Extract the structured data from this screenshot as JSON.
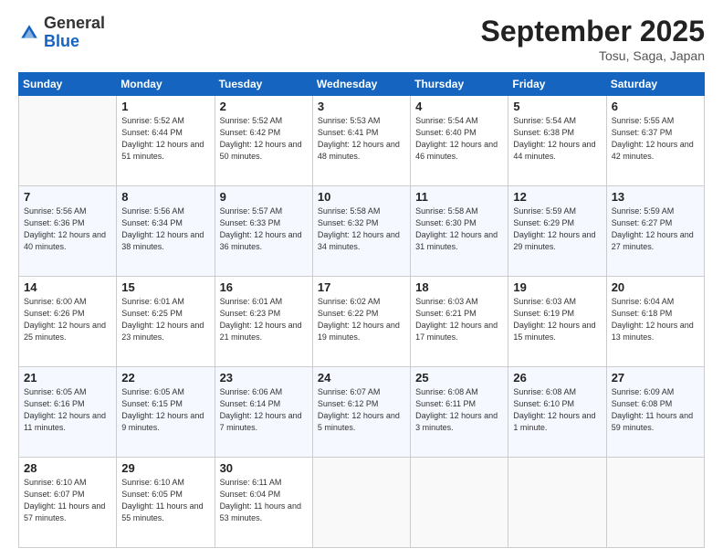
{
  "header": {
    "logo_general": "General",
    "logo_blue": "Blue",
    "month_title": "September 2025",
    "location": "Tosu, Saga, Japan"
  },
  "weekdays": [
    "Sunday",
    "Monday",
    "Tuesday",
    "Wednesday",
    "Thursday",
    "Friday",
    "Saturday"
  ],
  "weeks": [
    [
      {
        "day": null
      },
      {
        "day": "1",
        "sunrise": "Sunrise: 5:52 AM",
        "sunset": "Sunset: 6:44 PM",
        "daylight": "Daylight: 12 hours and 51 minutes."
      },
      {
        "day": "2",
        "sunrise": "Sunrise: 5:52 AM",
        "sunset": "Sunset: 6:42 PM",
        "daylight": "Daylight: 12 hours and 50 minutes."
      },
      {
        "day": "3",
        "sunrise": "Sunrise: 5:53 AM",
        "sunset": "Sunset: 6:41 PM",
        "daylight": "Daylight: 12 hours and 48 minutes."
      },
      {
        "day": "4",
        "sunrise": "Sunrise: 5:54 AM",
        "sunset": "Sunset: 6:40 PM",
        "daylight": "Daylight: 12 hours and 46 minutes."
      },
      {
        "day": "5",
        "sunrise": "Sunrise: 5:54 AM",
        "sunset": "Sunset: 6:38 PM",
        "daylight": "Daylight: 12 hours and 44 minutes."
      },
      {
        "day": "6",
        "sunrise": "Sunrise: 5:55 AM",
        "sunset": "Sunset: 6:37 PM",
        "daylight": "Daylight: 12 hours and 42 minutes."
      }
    ],
    [
      {
        "day": "7",
        "sunrise": "Sunrise: 5:56 AM",
        "sunset": "Sunset: 6:36 PM",
        "daylight": "Daylight: 12 hours and 40 minutes."
      },
      {
        "day": "8",
        "sunrise": "Sunrise: 5:56 AM",
        "sunset": "Sunset: 6:34 PM",
        "daylight": "Daylight: 12 hours and 38 minutes."
      },
      {
        "day": "9",
        "sunrise": "Sunrise: 5:57 AM",
        "sunset": "Sunset: 6:33 PM",
        "daylight": "Daylight: 12 hours and 36 minutes."
      },
      {
        "day": "10",
        "sunrise": "Sunrise: 5:58 AM",
        "sunset": "Sunset: 6:32 PM",
        "daylight": "Daylight: 12 hours and 34 minutes."
      },
      {
        "day": "11",
        "sunrise": "Sunrise: 5:58 AM",
        "sunset": "Sunset: 6:30 PM",
        "daylight": "Daylight: 12 hours and 31 minutes."
      },
      {
        "day": "12",
        "sunrise": "Sunrise: 5:59 AM",
        "sunset": "Sunset: 6:29 PM",
        "daylight": "Daylight: 12 hours and 29 minutes."
      },
      {
        "day": "13",
        "sunrise": "Sunrise: 5:59 AM",
        "sunset": "Sunset: 6:27 PM",
        "daylight": "Daylight: 12 hours and 27 minutes."
      }
    ],
    [
      {
        "day": "14",
        "sunrise": "Sunrise: 6:00 AM",
        "sunset": "Sunset: 6:26 PM",
        "daylight": "Daylight: 12 hours and 25 minutes."
      },
      {
        "day": "15",
        "sunrise": "Sunrise: 6:01 AM",
        "sunset": "Sunset: 6:25 PM",
        "daylight": "Daylight: 12 hours and 23 minutes."
      },
      {
        "day": "16",
        "sunrise": "Sunrise: 6:01 AM",
        "sunset": "Sunset: 6:23 PM",
        "daylight": "Daylight: 12 hours and 21 minutes."
      },
      {
        "day": "17",
        "sunrise": "Sunrise: 6:02 AM",
        "sunset": "Sunset: 6:22 PM",
        "daylight": "Daylight: 12 hours and 19 minutes."
      },
      {
        "day": "18",
        "sunrise": "Sunrise: 6:03 AM",
        "sunset": "Sunset: 6:21 PM",
        "daylight": "Daylight: 12 hours and 17 minutes."
      },
      {
        "day": "19",
        "sunrise": "Sunrise: 6:03 AM",
        "sunset": "Sunset: 6:19 PM",
        "daylight": "Daylight: 12 hours and 15 minutes."
      },
      {
        "day": "20",
        "sunrise": "Sunrise: 6:04 AM",
        "sunset": "Sunset: 6:18 PM",
        "daylight": "Daylight: 12 hours and 13 minutes."
      }
    ],
    [
      {
        "day": "21",
        "sunrise": "Sunrise: 6:05 AM",
        "sunset": "Sunset: 6:16 PM",
        "daylight": "Daylight: 12 hours and 11 minutes."
      },
      {
        "day": "22",
        "sunrise": "Sunrise: 6:05 AM",
        "sunset": "Sunset: 6:15 PM",
        "daylight": "Daylight: 12 hours and 9 minutes."
      },
      {
        "day": "23",
        "sunrise": "Sunrise: 6:06 AM",
        "sunset": "Sunset: 6:14 PM",
        "daylight": "Daylight: 12 hours and 7 minutes."
      },
      {
        "day": "24",
        "sunrise": "Sunrise: 6:07 AM",
        "sunset": "Sunset: 6:12 PM",
        "daylight": "Daylight: 12 hours and 5 minutes."
      },
      {
        "day": "25",
        "sunrise": "Sunrise: 6:08 AM",
        "sunset": "Sunset: 6:11 PM",
        "daylight": "Daylight: 12 hours and 3 minutes."
      },
      {
        "day": "26",
        "sunrise": "Sunrise: 6:08 AM",
        "sunset": "Sunset: 6:10 PM",
        "daylight": "Daylight: 12 hours and 1 minute."
      },
      {
        "day": "27",
        "sunrise": "Sunrise: 6:09 AM",
        "sunset": "Sunset: 6:08 PM",
        "daylight": "Daylight: 11 hours and 59 minutes."
      }
    ],
    [
      {
        "day": "28",
        "sunrise": "Sunrise: 6:10 AM",
        "sunset": "Sunset: 6:07 PM",
        "daylight": "Daylight: 11 hours and 57 minutes."
      },
      {
        "day": "29",
        "sunrise": "Sunrise: 6:10 AM",
        "sunset": "Sunset: 6:05 PM",
        "daylight": "Daylight: 11 hours and 55 minutes."
      },
      {
        "day": "30",
        "sunrise": "Sunrise: 6:11 AM",
        "sunset": "Sunset: 6:04 PM",
        "daylight": "Daylight: 11 hours and 53 minutes."
      },
      {
        "day": null
      },
      {
        "day": null
      },
      {
        "day": null
      },
      {
        "day": null
      }
    ]
  ]
}
